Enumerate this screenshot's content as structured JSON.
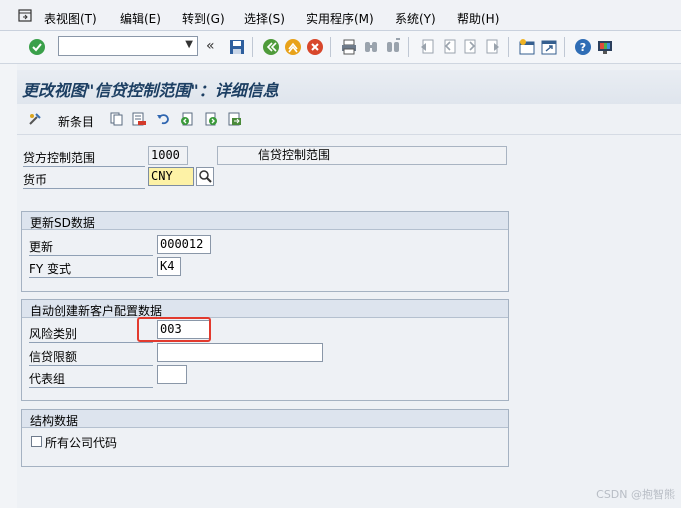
{
  "menu": {
    "items": [
      "表视图(T)",
      "编辑(E)",
      "转到(G)",
      "选择(S)",
      "实用程序(M)",
      "系统(Y)",
      "帮助(H)"
    ]
  },
  "toolbar": {
    "command_value": ""
  },
  "screen": {
    "title": "更改视图\"信贷控制范围\"：详细信息"
  },
  "app_toolbar": {
    "new_entries_label": "新条目"
  },
  "header_fields": {
    "credit_control_area_label": "贷方控制范围",
    "credit_control_area_value": "1000",
    "credit_control_area_desc": "信贷控制范围",
    "currency_label": "货币",
    "currency_value": "CNY"
  },
  "update_group": {
    "title": "更新SD数据",
    "update_label": "更新",
    "update_value": "000012",
    "fy_variant_label": "FY 变式",
    "fy_variant_value": "K4"
  },
  "auto_create_group": {
    "title": "自动创建新客户配置数据",
    "risk_category_label": "风险类别",
    "risk_category_value": "003",
    "credit_limit_label": "信贷限额",
    "credit_limit_value": "",
    "rep_group_label": "代表组",
    "rep_group_value": ""
  },
  "org_group": {
    "title": "结构数据",
    "all_company_codes_label": "所有公司代码",
    "all_company_codes_checked": false
  },
  "watermark": "CSDN @抱智熊",
  "colors": {
    "title_text": "#1d3f63",
    "highlight_box": "#e23a2e",
    "focus_field": "#fdf2a6"
  }
}
